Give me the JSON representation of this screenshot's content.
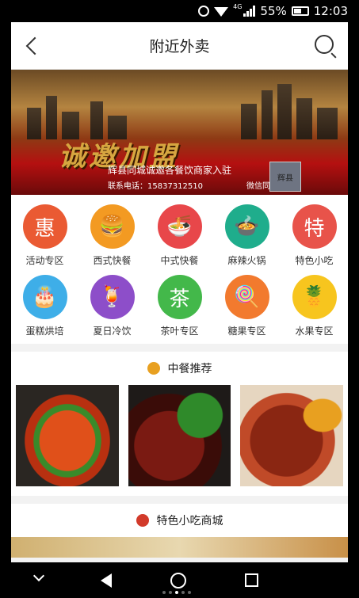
{
  "status": {
    "net_type": "4G",
    "battery": "55%",
    "time": "12:03"
  },
  "header": {
    "title": "附近外卖"
  },
  "banner": {
    "big_text": "诚邀加盟",
    "subtitle": "辉县同城诚邀各餐饮商家入驻",
    "contact": "联系电话：15837312510",
    "sync": "微信同步"
  },
  "categories": [
    {
      "label": "活动专区",
      "glyph": "惠",
      "color": "#ea5a33"
    },
    {
      "label": "西式快餐",
      "glyph": "🍔",
      "color": "#f39a22"
    },
    {
      "label": "中式快餐",
      "glyph": "🍜",
      "color": "#e8474a"
    },
    {
      "label": "麻辣火锅",
      "glyph": "🍲",
      "color": "#1fad8c"
    },
    {
      "label": "特色小吃",
      "glyph": "特",
      "color": "#e8534a"
    },
    {
      "label": "蛋糕烘培",
      "glyph": "🎂",
      "color": "#3eaee8"
    },
    {
      "label": "夏日冷饮",
      "glyph": "🍹",
      "color": "#8d4ec9"
    },
    {
      "label": "茶叶专区",
      "glyph": "茶",
      "color": "#43b84a"
    },
    {
      "label": "糖果专区",
      "glyph": "🍭",
      "color": "#f27a2e"
    },
    {
      "label": "水果专区",
      "glyph": "🍍",
      "color": "#f7c51e"
    }
  ],
  "sections": [
    {
      "title": "中餐推荐",
      "icon_color": "#e8a020"
    },
    {
      "title": "特色小吃商城",
      "icon_color": "#d23a2a"
    }
  ]
}
